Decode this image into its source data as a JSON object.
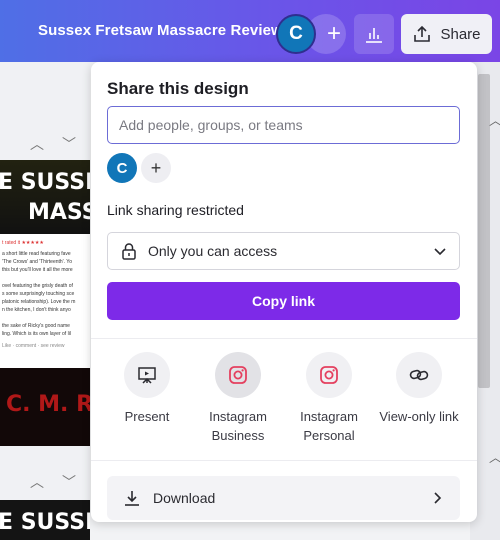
{
  "header": {
    "doc_title": "Sussex Fretsaw Massacre Review",
    "avatar_initial": "C",
    "add_symbol": "+",
    "share_label": "Share"
  },
  "canvas": {
    "banner1_line1": "E SUSSEX",
    "banner1_line2": "MASSA",
    "tiny_lines": [
      "t rated it ★★★★★",
      "a short little read featuring fave",
      "'The Crows' and 'Thirteenth'. Yo",
      "this but you'll love it all the more",
      "",
      "ovel featuring the grisly death of",
      "s some surprisingly touching sce",
      "platonic relationship). Love the m",
      "n the kitchen, I don't think anyo",
      "",
      "the sake of Ricky's good name",
      "ling. Which is its own layer of lil",
      "Like · comment · see review"
    ],
    "banner2_text": "C. M. R",
    "banner3_text": "E SUSSEX FRETSAW"
  },
  "panel": {
    "title": "Share this design",
    "people_placeholder": "Add people, groups, or teams",
    "avatar_initial": "C",
    "add_symbol": "+",
    "link_label": "Link sharing restricted",
    "access_value": "Only you can access",
    "copy_label": "Copy link",
    "options": [
      {
        "icon": "present-icon",
        "label": "Present"
      },
      {
        "icon": "instagram-icon",
        "label": "Instagram Business"
      },
      {
        "icon": "instagram-icon",
        "label": "Instagram Personal"
      },
      {
        "icon": "link-icon",
        "label": "View-only link"
      }
    ],
    "download_label": "Download"
  },
  "colors": {
    "accent": "#7d2ae8",
    "avatar": "#1176b8",
    "instagram": "#e4405f"
  }
}
